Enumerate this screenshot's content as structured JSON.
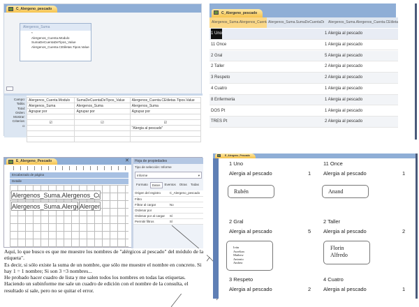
{
  "query_design": {
    "tab": "C_Alergeno_pescado",
    "table_title": "Alergenos_Suma",
    "fields": [
      "*",
      "Alergenos_Cuenta.Modulo",
      "SumaDeCuentaDeTipos_Value",
      "Alergenos_Cuenta.CEtiletas.Tipos.Value"
    ],
    "row_labels": [
      "Campo:",
      "Tabla:",
      "Total:",
      "Orden:",
      "Mostrar:",
      "Criterios:",
      "o:"
    ],
    "columns": [
      {
        "campo": "Alergenos_Cuenta.Modulo",
        "tabla": "Alergenos_Suma",
        "total": "Agrupar por",
        "criterios": ""
      },
      {
        "campo": "SumaDeCuentaDeTipos_Value",
        "tabla": "Alergenos_Suma",
        "total": "Agrupar por",
        "criterios": ""
      },
      {
        "campo": "Alergenos_Cuenta.CEtiletas.Tipos.Value",
        "tabla": "Alergenos_Suma",
        "total": "Agrupar por",
        "criterios": "\"Alergia al pescado\""
      }
    ]
  },
  "datasheet": {
    "tab": "C_Alergeno_pescado",
    "headers": [
      "Alergenos_Suma.Alergenos_Cuenta.Modulo",
      "Alergenos_Suma.SumaDeCuentaDeTipos_Value",
      "Alergenos_Suma.Alergenos_Cuenta.CEtiletas.Tipos.Value"
    ],
    "rows": [
      [
        "1 Uno",
        "",
        "1 Alergia al pescado"
      ],
      [
        "11 Once",
        "",
        "1 Alergia al pescado"
      ],
      [
        "2 Gral",
        "",
        "5 Alergia al pescado"
      ],
      [
        "2 Taller",
        "",
        "2 Alergia al pescado"
      ],
      [
        "3 Respeto",
        "",
        "2 Alergia al pescado"
      ],
      [
        "4 Cuatro",
        "",
        "1 Alergia al pescado"
      ],
      [
        "8 Enfermeria",
        "",
        "1 Alergia al pescado"
      ],
      [
        "DOS Pt",
        "",
        "1 Alergia al pescado"
      ],
      [
        "TRES Pt",
        "",
        "2 Alergia al pescado"
      ]
    ]
  },
  "report_design": {
    "tab": "E_Alergeno_Pescado",
    "section_header": "Encabezado de página",
    "section_detail": "Detalle",
    "field1": "Alergenos_Suma.Alergenos_Cuen",
    "field2": "Alergenos_Suma.Alergen",
    "field3": "Alergen",
    "props": {
      "title": "Hoja de propiedades",
      "selection_type": "Tipo de selección: Informe",
      "selected": "Informe",
      "tabs": [
        "Formato",
        "Datos",
        "Eventos",
        "Otras",
        "Todas"
      ],
      "rows": [
        [
          "Origen del registro",
          "C_Alergeno_pescado"
        ],
        [
          "Filtro",
          ""
        ],
        [
          "Filtrar al cargar",
          "No"
        ],
        [
          "Ordenar por",
          ""
        ],
        [
          "Ordenar por al cargar",
          "Sí"
        ],
        [
          "Permitir filtros",
          "Sí"
        ]
      ]
    }
  },
  "note": [
    "Aquí, lo que busco es que me muestre los nombres de \"alérgicos al pescado\" del módulo de la etiqueta\".",
    "Es decir, si sólo existe la suma de un nombre, que sólo me muestre el nombre en concreto. Si hay 1 = 1 nombre; Si son 3 =3 nombres...",
    "He probado hacer cuadro de lista y me salen todos los nombres en todas las etiquetas.",
    "Haciendo un subinforme me sale un cuadro de edición con el nombre de la consulta, el resultado sí sale, pero no se quitar el error."
  ],
  "report_preview": {
    "tab": "E_Alergeno_Pescado",
    "cards": [
      {
        "module": "1 Uno",
        "type": "Alergia al pescado",
        "count": "1",
        "names": "Rubén"
      },
      {
        "module": "11 Once",
        "type": "Alergia al pescado",
        "count": "1",
        "names": "Anand"
      },
      {
        "module": "2 Gral",
        "type": "Alergia al pescado",
        "count": "5",
        "names": "Iván\nAurelian\nMathew\nAntonio\nAndrea"
      },
      {
        "module": "2 Taller",
        "type": "Alergia al pescado",
        "count": "2",
        "names": "Florin\nAlfredo"
      },
      {
        "module": "3 Respeto",
        "type": "Alergia al pescado",
        "count": "2",
        "names": ""
      },
      {
        "module": "4 Cuatro",
        "type": "Alergia al pescado",
        "count": "1",
        "names": ""
      }
    ]
  }
}
